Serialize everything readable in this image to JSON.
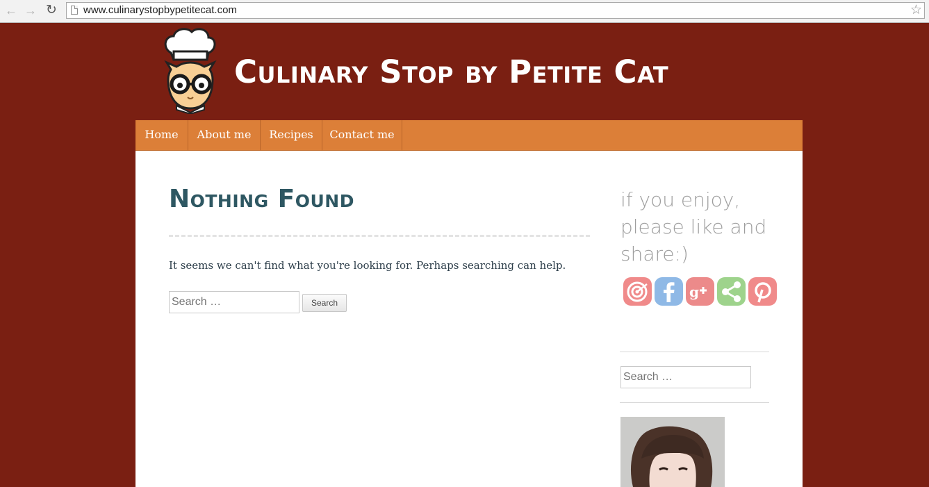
{
  "browser": {
    "url": "www.culinarystopbypetitecat.com",
    "back_icon": "←",
    "forward_icon": "→",
    "reload_icon": "↻",
    "star_icon": "☆"
  },
  "header": {
    "site_title": "Culinary Stop by Petite Cat"
  },
  "menu": {
    "items": [
      {
        "label": "Home"
      },
      {
        "label": "About me"
      },
      {
        "label": "Recipes"
      },
      {
        "label": "Contact me"
      }
    ]
  },
  "main": {
    "title": "Nothing Found",
    "message": "It seems we can't find what you're looking for. Perhaps searching can help.",
    "search_placeholder": "Search …",
    "search_button": "Search"
  },
  "sidebar": {
    "share_text": "if you enjoy, please like and share:)",
    "social_icons": [
      "target-icon",
      "facebook-icon",
      "google-plus-icon",
      "share-icon",
      "pinterest-icon"
    ],
    "search_placeholder": "Search …"
  },
  "colors": {
    "background": "#7a1f12",
    "menu": "#dc7f38",
    "title": "#2e5762"
  }
}
